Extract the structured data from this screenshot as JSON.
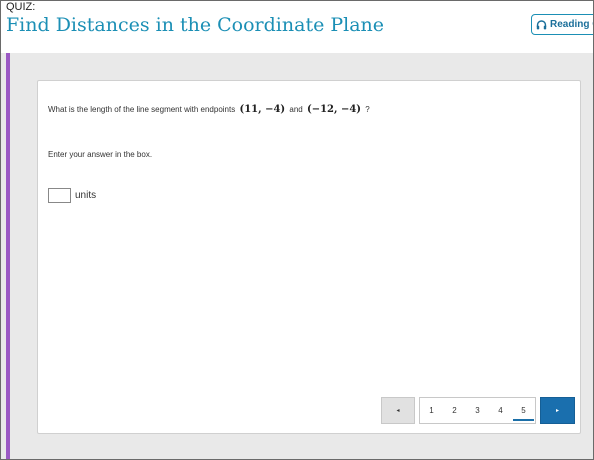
{
  "header": {
    "quiz_label": "QUIZ:",
    "title": "Find Distances in the Coordinate Plane",
    "reading_button": "Reading O"
  },
  "question": {
    "prompt_start": "What is the length of the line segment with endpoints",
    "point_a": "(11, −4)",
    "conjunction": "and",
    "point_b": "(−12, −4)",
    "prompt_end": "?",
    "instruction": "Enter your answer in the box.",
    "answer_value": "",
    "units_label": "units"
  },
  "pagination": {
    "prev_symbol": "◂",
    "next_symbol": "▸",
    "pages": [
      "1",
      "2",
      "3",
      "4",
      "5"
    ],
    "current_page": "5"
  },
  "colors": {
    "title": "#1b8fb5",
    "accent_bar": "#9b59c4",
    "next_button": "#1a6fae",
    "background": "#e9e9e9"
  },
  "icons": {
    "reading": "headphones-icon"
  }
}
